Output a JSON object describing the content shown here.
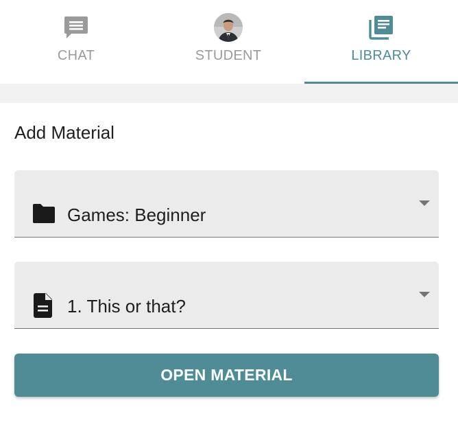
{
  "tabs": [
    {
      "label": "CHAT",
      "icon": "chat-icon",
      "active": false
    },
    {
      "label": "STUDENT",
      "icon": "student-avatar",
      "active": false
    },
    {
      "label": "LIBRARY",
      "icon": "library-icon",
      "active": true
    }
  ],
  "section_title": "Add Material",
  "folder_select": {
    "icon": "folder-icon",
    "value": "Games: Beginner"
  },
  "material_select": {
    "icon": "document-icon",
    "value": "1. This or that?"
  },
  "open_button": {
    "label": "OPEN MATERIAL"
  },
  "colors": {
    "accent": "#4f8c96",
    "inactive_tab": "#9a9a9a",
    "field_bg": "#ebebeb",
    "band_bg": "#f2f2f2"
  }
}
